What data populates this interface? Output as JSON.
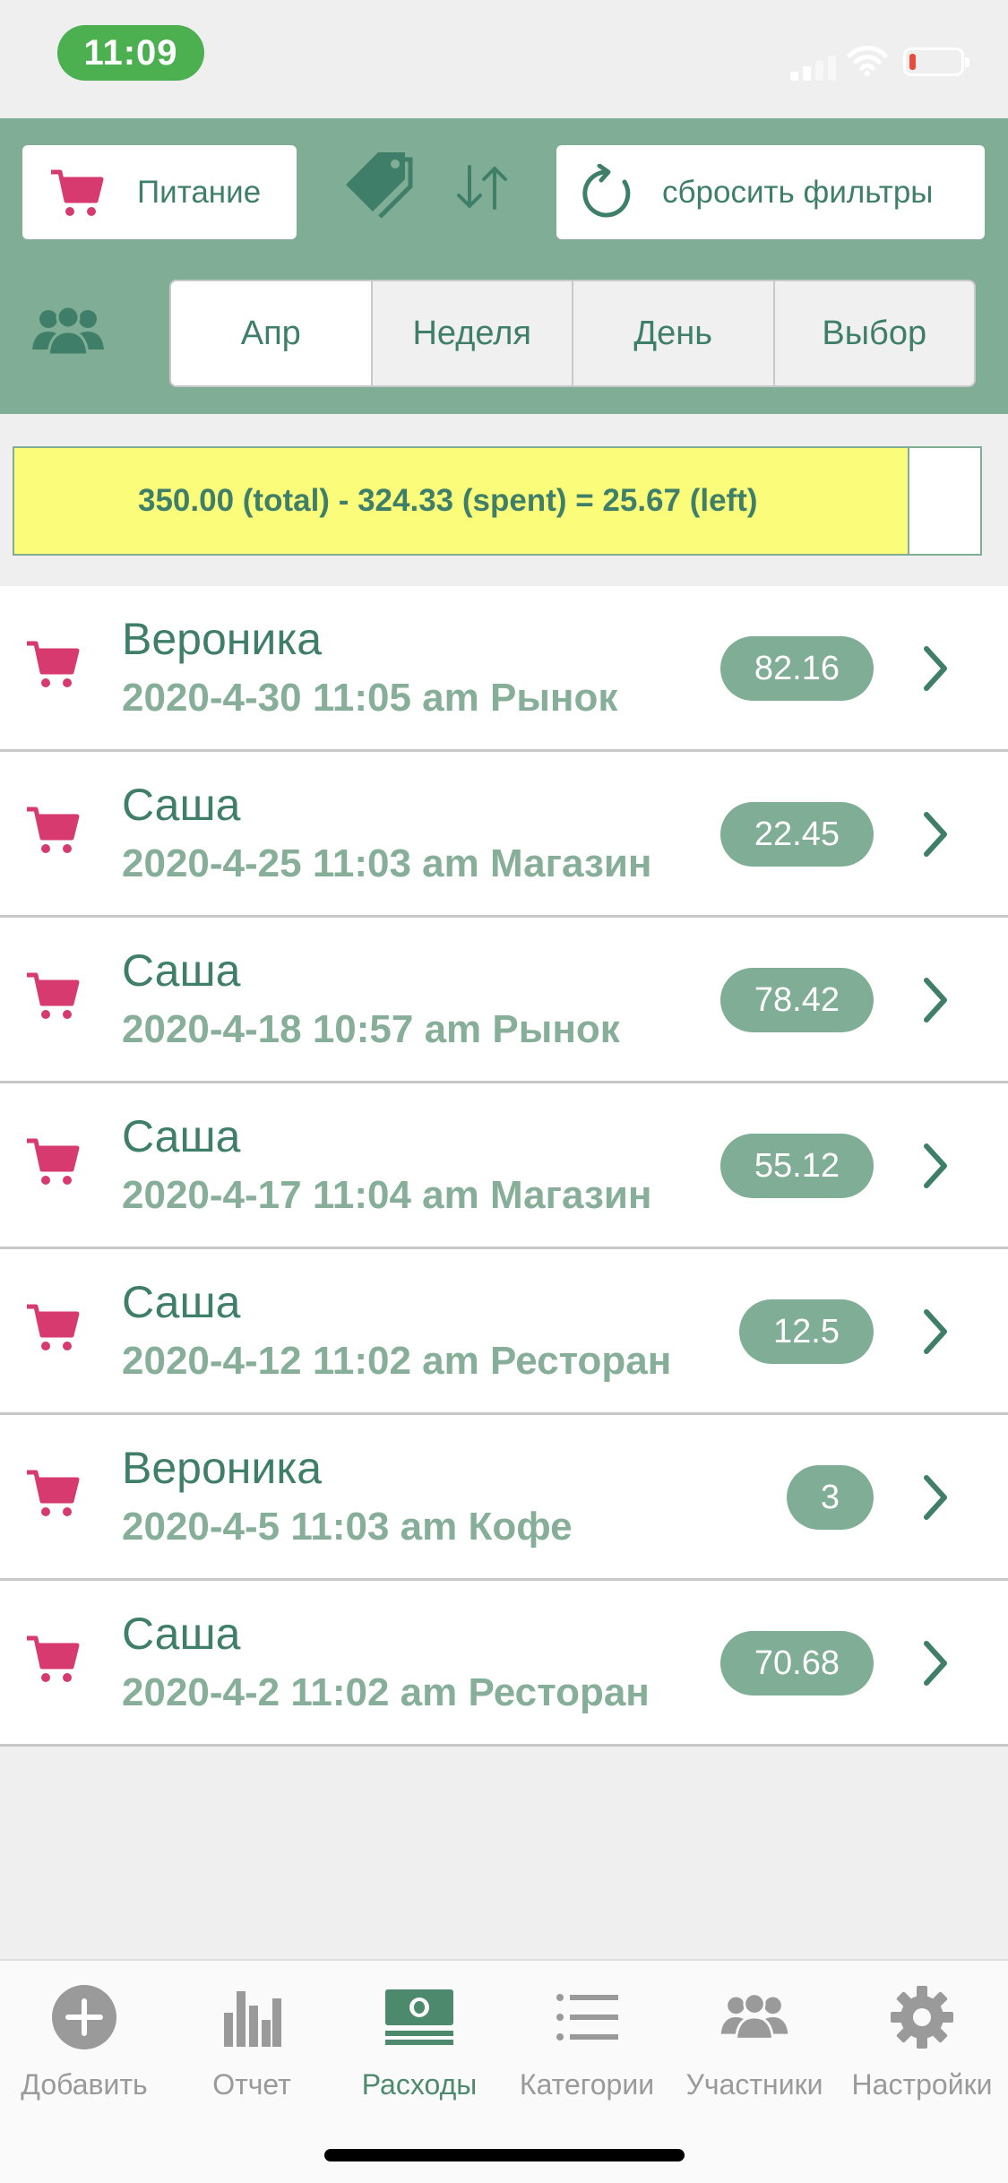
{
  "status_bar": {
    "time": "11:09"
  },
  "header": {
    "category_label": "Питание",
    "reset_label": "сбросить фильтры",
    "segments": [
      "Апр",
      "Неделя",
      "День",
      "Выбор"
    ]
  },
  "budget": {
    "text": "350.00 (total) - 324.33 (spent) = 25.67 (left)",
    "spent_fraction": 0.927
  },
  "expenses": [
    {
      "name": "Вероника",
      "detail": "2020-4-30 11:05 am Рынок",
      "amount": "82.16"
    },
    {
      "name": "Саша",
      "detail": "2020-4-25 11:03 am Магазин",
      "amount": "22.45"
    },
    {
      "name": "Саша",
      "detail": "2020-4-18 10:57 am Рынок",
      "amount": "78.42"
    },
    {
      "name": "Саша",
      "detail": "2020-4-17 11:04 am Магазин",
      "amount": "55.12"
    },
    {
      "name": "Саша",
      "detail": "2020-4-12 11:02 am Ресторан",
      "amount": "12.5"
    },
    {
      "name": "Вероника",
      "detail": "2020-4-5 11:03 am Кофе",
      "amount": "3"
    },
    {
      "name": "Саша",
      "detail": "2020-4-2 11:02 am Ресторан",
      "amount": "70.68"
    }
  ],
  "tabbar": {
    "items": [
      {
        "label": "Добавить",
        "icon": "add-circle-icon"
      },
      {
        "label": "Отчет",
        "icon": "bar-chart-icon"
      },
      {
        "label": "Расходы",
        "icon": "money-icon"
      },
      {
        "label": "Категории",
        "icon": "list-icon"
      },
      {
        "label": "Участники",
        "icon": "people-icon"
      },
      {
        "label": "Настройки",
        "icon": "gear-icon"
      }
    ],
    "active_index": 2
  },
  "colors": {
    "header_bg": "#80ad95",
    "accent_text": "#3f7f6a",
    "cart_pink": "#d63a6e",
    "budget_yellow": "#fbfc7a",
    "status_green": "#4caf50"
  }
}
